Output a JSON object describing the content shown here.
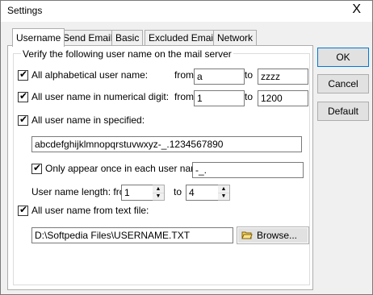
{
  "window": {
    "title": "Settings",
    "close_glyph": "X"
  },
  "tabs": [
    {
      "label": "Username"
    },
    {
      "label": "Send Email"
    },
    {
      "label": "Basic"
    },
    {
      "label": "Excluded Email"
    },
    {
      "label": "Network"
    }
  ],
  "group": {
    "legend": "Verify the following user name on the mail server"
  },
  "alpha": {
    "label": "All alphabetical user name:",
    "from_label": "from",
    "from_value": "a",
    "to_label": "to",
    "to_value": "zzzz",
    "checked": true
  },
  "numeric": {
    "label": "All user name in numerical digit:",
    "from_label": "from",
    "from_value": "1",
    "to_label": "to",
    "to_value": "1200",
    "checked": true
  },
  "specified": {
    "label": "All user name in specified:",
    "charset": "abcdefghijklmnopqrstuvwxyz-_.1234567890",
    "checked": true
  },
  "once": {
    "label": "Only appear once in each user name:",
    "value": "-_.",
    "checked": true
  },
  "length": {
    "label": "User name length: from",
    "from_value": "1",
    "to_label": "to",
    "to_value": "4"
  },
  "textfile": {
    "label": "All user name from text file:",
    "path": "D:\\Softpedia Files\\USERNAME.TXT",
    "browse_label": "Browse...",
    "checked": true
  },
  "buttons": {
    "ok": "OK",
    "cancel": "Cancel",
    "default": "Default"
  },
  "icons": {
    "check": "checkmark-icon",
    "browse": "folder-icon",
    "spin_up": "spin-up-icon",
    "spin_down": "spin-down-icon",
    "check_glyph": "✔",
    "spin_up_glyph": "▲",
    "spin_down_glyph": "▼"
  }
}
